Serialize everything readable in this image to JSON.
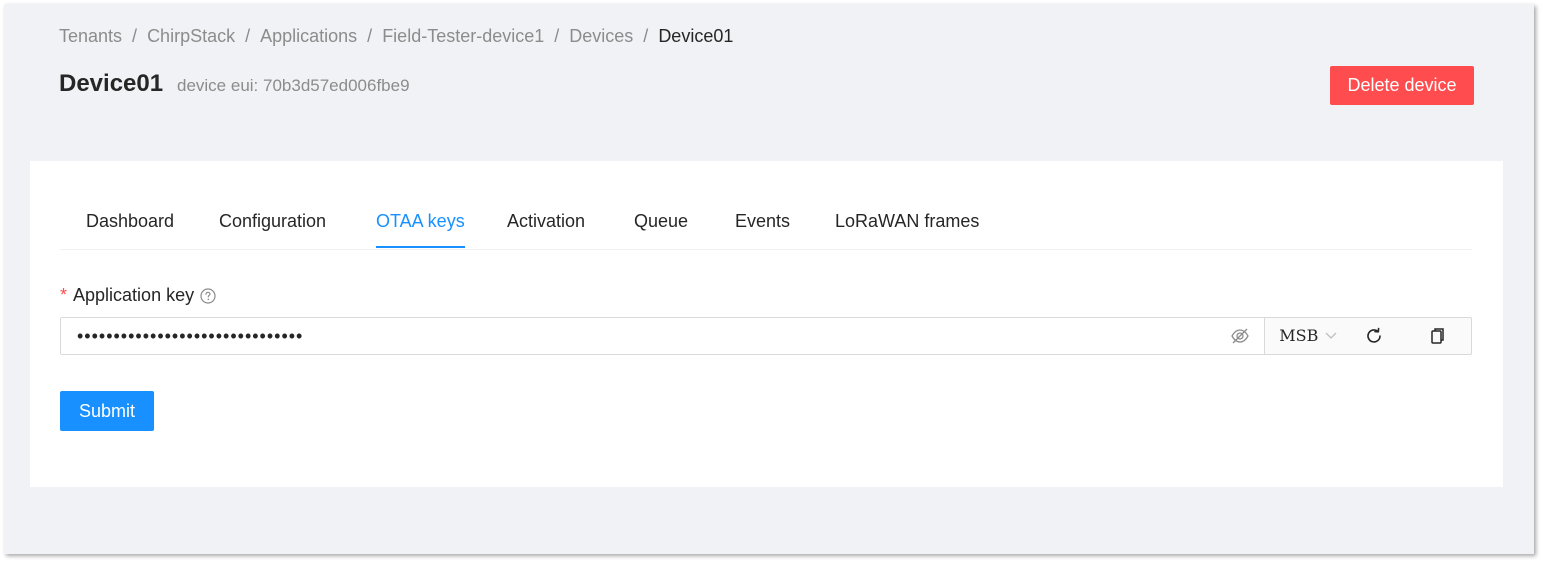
{
  "breadcrumb": {
    "items": [
      "Tenants",
      "ChirpStack",
      "Applications",
      "Field-Tester-device1",
      "Devices",
      "Device01"
    ],
    "separator": "/"
  },
  "header": {
    "title": "Device01",
    "subtitle": "device eui: 70b3d57ed006fbe9",
    "delete_label": "Delete device"
  },
  "tabs": [
    {
      "label": "Dashboard",
      "active": false
    },
    {
      "label": "Configuration",
      "active": false
    },
    {
      "label": "OTAA keys",
      "active": true
    },
    {
      "label": "Activation",
      "active": false
    },
    {
      "label": "Queue",
      "active": false
    },
    {
      "label": "Events",
      "active": false
    },
    {
      "label": "LoRaWAN frames",
      "active": false
    }
  ],
  "form": {
    "required_mark": "*",
    "app_key_label": "Application key",
    "app_key_value": "•••••••••••••••••••••••••••••••",
    "byte_order": "MSB",
    "submit_label": "Submit"
  },
  "icons": {
    "help": "question-circle-icon",
    "visibility": "eye-invisible-icon",
    "dropdown": "chevron-down-icon",
    "refresh": "reload-icon",
    "copy": "copy-icon"
  },
  "colors": {
    "primary": "#1890ff",
    "danger": "#ff4d4f",
    "background": "#f0f2f5"
  }
}
